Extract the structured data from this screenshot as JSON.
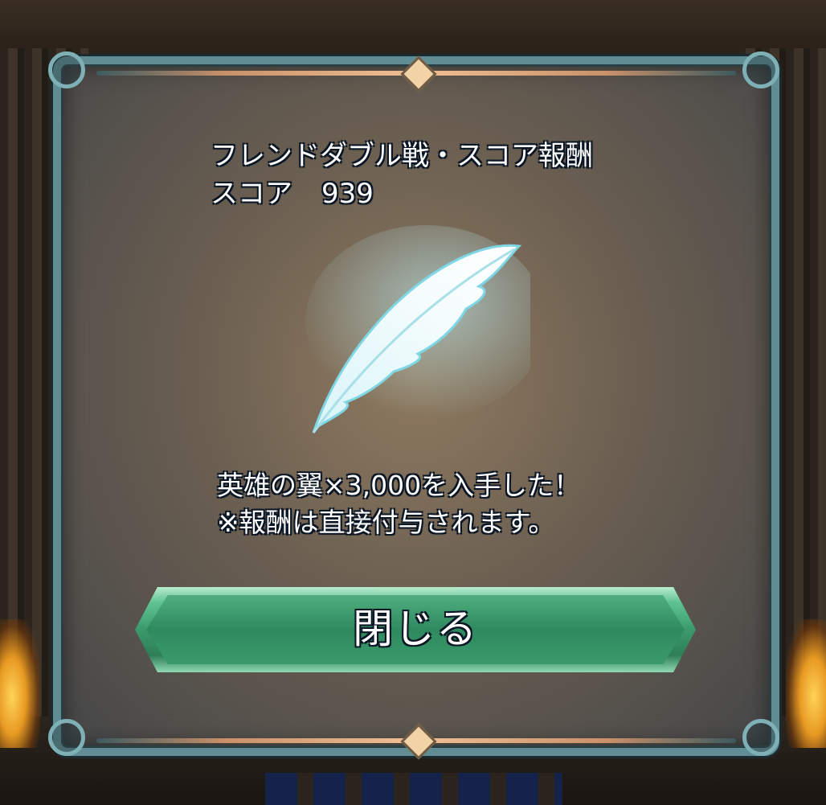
{
  "dialog": {
    "title": "フレンドダブル戦・スコア報酬",
    "score_label": "スコア",
    "score_value": "939",
    "reward_icon": "feather-icon",
    "reward_message": "英雄の翼×3,000を入手した！",
    "note": "※報酬は直接付与されます。",
    "close_label": "閉じる"
  },
  "colors": {
    "frame": "#5f8d93",
    "button_green": "#3b9a6c",
    "text_outline": "#0c1726"
  }
}
